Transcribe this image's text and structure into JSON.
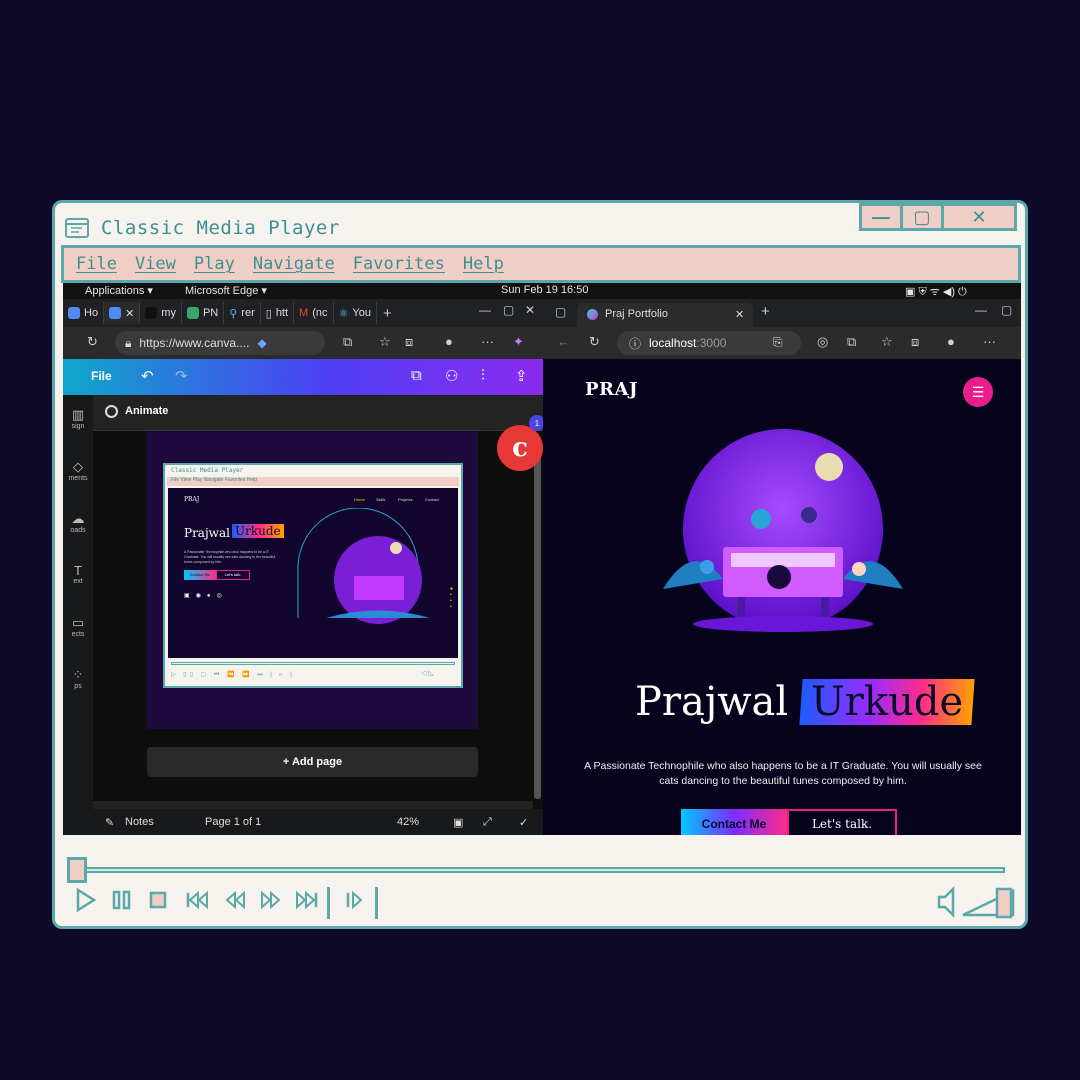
{
  "player": {
    "title": "Classic Media Player",
    "menu": [
      "File",
      "View",
      "Play",
      "Navigate",
      "Favorites",
      "Help"
    ],
    "window_buttons": [
      "minimize",
      "maximize",
      "close"
    ]
  },
  "os_bar": {
    "applications": "Applications ▾",
    "active_app": "Microsoft Edge ▾",
    "clock": "Sun Feb 19  16:50"
  },
  "left_browser": {
    "tabs": [
      "Ho",
      "",
      "my",
      "PN",
      "rer",
      "htt",
      "(nc",
      "You"
    ],
    "url": "https://www.canva....",
    "toolbar_file": "File",
    "animate": "Animate",
    "add_page": "+ Add page",
    "notes": "Notes",
    "page_info": "Page 1 of 1",
    "zoom": "42%",
    "fab_badge": "1",
    "side_rail": [
      "sign",
      "ments",
      "oads",
      "ext",
      "ects",
      "ps"
    ],
    "mini_player": {
      "title": "Classic Media Player",
      "menu": "File  View  Play  Navigate  Favorites  Help",
      "brand": "PRAJ",
      "nav": [
        "Home",
        "Skills",
        "Projects",
        "Contact"
      ],
      "first_name": "Prajwal",
      "last_name": "Urkude",
      "desc": "A Passionate Technophile who also happens to be a IT Graduate. You will usually see cats dancing to the beautiful tunes composed by him.",
      "btn_contact": "Contact Me",
      "btn_talk": "Let's talk."
    }
  },
  "right_browser": {
    "tab_title": "Praj Portfolio",
    "url_host": "localhost",
    "url_port": ":3000",
    "site": {
      "brand": "PRAJ",
      "first_name": "Prajwal",
      "last_name": "Urkude",
      "description": "A Passionate Technophile who also happens to be a IT Graduate. You will usually see cats dancing to the beautiful tunes composed by him.",
      "btn_contact": "Contact Me",
      "btn_talk": "Let's talk."
    }
  },
  "controls": {
    "buttons": [
      "play",
      "pause",
      "stop",
      "skip-back",
      "rewind",
      "fast-forward",
      "skip-forward",
      "frame-step"
    ],
    "seek_position": 0.01,
    "volume_icon": "speaker-icon"
  }
}
